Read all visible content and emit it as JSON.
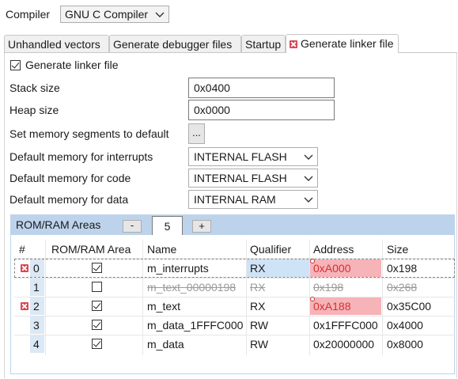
{
  "compiler": {
    "label": "Compiler",
    "value": "GNU C Compiler"
  },
  "tabs": [
    {
      "label": "Unhandled vectors"
    },
    {
      "label": "Generate debugger files"
    },
    {
      "label": "Startup"
    },
    {
      "label": "Generate linker file",
      "active": true,
      "has_error": true
    }
  ],
  "generate_linker_file": {
    "label": "Generate linker file",
    "checked": true
  },
  "stack_size": {
    "label": "Stack size",
    "value": "0x0400"
  },
  "heap_size": {
    "label": "Heap size",
    "value": "0x0000"
  },
  "memory_segments": {
    "label": "Set memory segments to default",
    "button": "..."
  },
  "default_interrupts": {
    "label": "Default memory for interrupts",
    "value": "INTERNAL FLASH"
  },
  "default_code": {
    "label": "Default memory for code",
    "value": "INTERNAL FLASH"
  },
  "default_data": {
    "label": "Default memory for data",
    "value": "INTERNAL RAM"
  },
  "rom_ram": {
    "title": "ROM/RAM Areas",
    "minus": "-",
    "count": "5",
    "plus": "+",
    "columns": [
      "#",
      "ROM/RAM Area",
      "Name",
      "Qualifier",
      "Address",
      "Size"
    ],
    "rows": [
      {
        "num": "0",
        "checked": true,
        "name": "m_interrupts",
        "qualifier": "RX",
        "address": "0xA000",
        "size": "0x198",
        "error": true,
        "address_error": true,
        "disabled": false
      },
      {
        "num": "1",
        "checked": false,
        "name": "m_text_00000198",
        "qualifier": "RX",
        "address": "0x198",
        "size": "0x268",
        "error": false,
        "address_error": false,
        "disabled": true
      },
      {
        "num": "2",
        "checked": true,
        "name": "m_text",
        "qualifier": "RX",
        "address": "0xA188",
        "size": "0x35C00",
        "error": true,
        "address_error": true,
        "disabled": false
      },
      {
        "num": "3",
        "checked": true,
        "name": "m_data_1FFFC000",
        "qualifier": "RW",
        "address": "0x1FFFC000",
        "size": "0x4000",
        "error": false,
        "address_error": false,
        "disabled": false
      },
      {
        "num": "4",
        "checked": true,
        "name": "m_data",
        "qualifier": "RW",
        "address": "0x20000000",
        "size": "0x8000",
        "error": false,
        "address_error": false,
        "disabled": false
      }
    ]
  },
  "colors": {
    "group_header": "#bdd3ec",
    "address_error_bg": "#f6b3b8",
    "qualifier_selected_bg": "#cfe3f7",
    "error_icon": "#d9434f"
  }
}
